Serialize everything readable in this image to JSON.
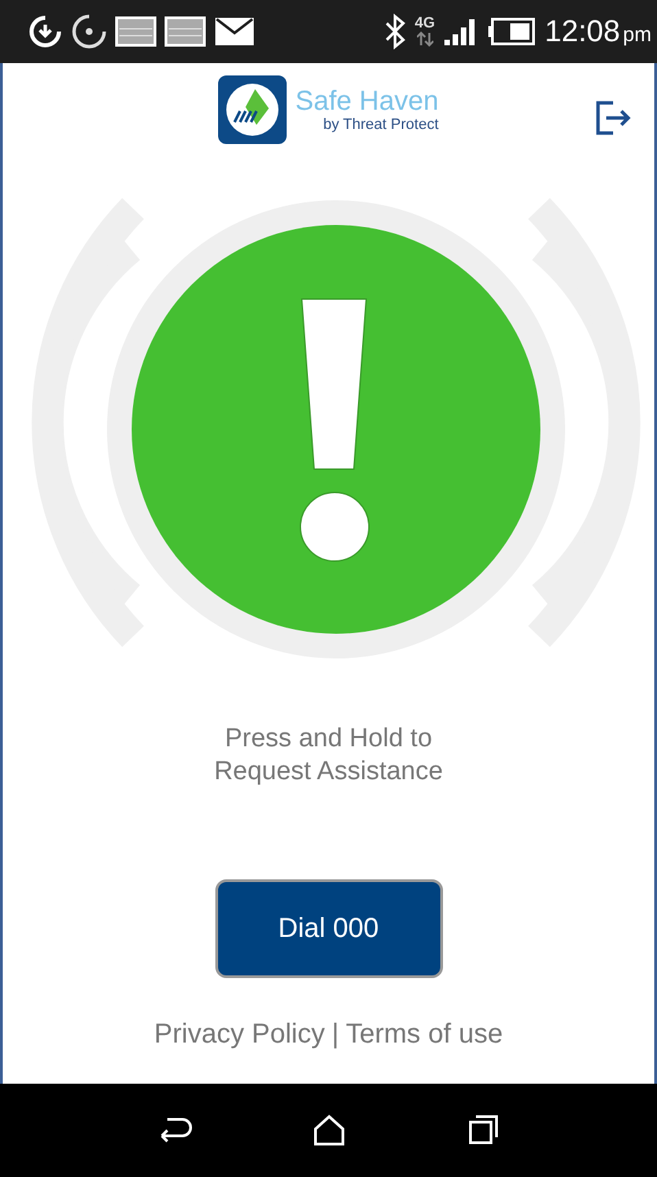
{
  "status_bar": {
    "network": "4G",
    "time": "12:08",
    "period": "pm"
  },
  "header": {
    "app_name": "Safe Haven",
    "tagline": "by Threat Protect"
  },
  "instruction": "Press and Hold to Request Assistance",
  "dial_button": {
    "label": "Dial 000"
  },
  "links": [
    {
      "label": "Privacy Policy"
    },
    {
      "label": "Terms of use"
    }
  ],
  "link_separator": "|"
}
